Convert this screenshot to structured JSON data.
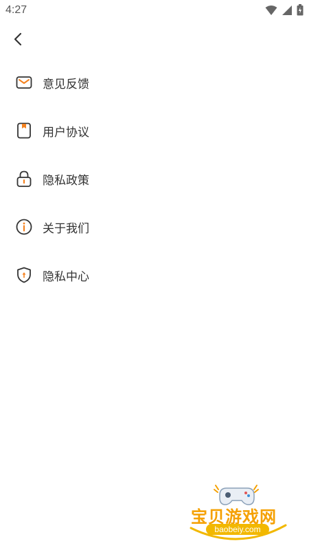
{
  "status_bar": {
    "time": "4:27"
  },
  "menu": {
    "items": [
      {
        "label": "意见反馈",
        "icon": "mail-icon"
      },
      {
        "label": "用户协议",
        "icon": "document-icon"
      },
      {
        "label": "隐私政策",
        "icon": "lock-icon"
      },
      {
        "label": "关于我们",
        "icon": "info-icon"
      },
      {
        "label": "隐私中心",
        "icon": "shield-icon"
      }
    ]
  },
  "watermark": {
    "title": "宝贝游戏网",
    "url": "baobeiy.com"
  },
  "colors": {
    "accent": "#f5821f",
    "icon_outline": "#333333",
    "watermark": "#f5a000"
  }
}
